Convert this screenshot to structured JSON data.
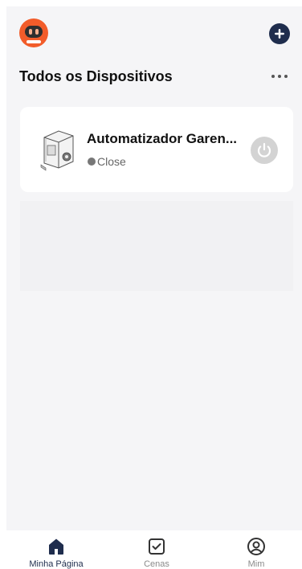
{
  "header": {
    "avatar_icon": "robot-avatar-icon",
    "add_icon": "plus-icon",
    "more_icon": "more-horizontal-icon"
  },
  "main": {
    "title": "Todos os Dispositivos",
    "devices": [
      {
        "name": "Automatizador Garen...",
        "status": "Close",
        "icon": "gate-motor-icon",
        "power_icon": "power-icon"
      }
    ]
  },
  "tabbar": {
    "tabs": [
      {
        "label": "Minha Página",
        "icon": "home-icon",
        "active": true
      },
      {
        "label": "Cenas",
        "icon": "checkbox-icon",
        "active": false
      },
      {
        "label": "Mim",
        "icon": "user-icon",
        "active": false
      }
    ]
  },
  "colors": {
    "accent": "#1f2d4d",
    "avatar": "#f25c2a",
    "background": "#f5f5f7",
    "card": "#ffffff",
    "power_off": "#d3d3d3"
  }
}
